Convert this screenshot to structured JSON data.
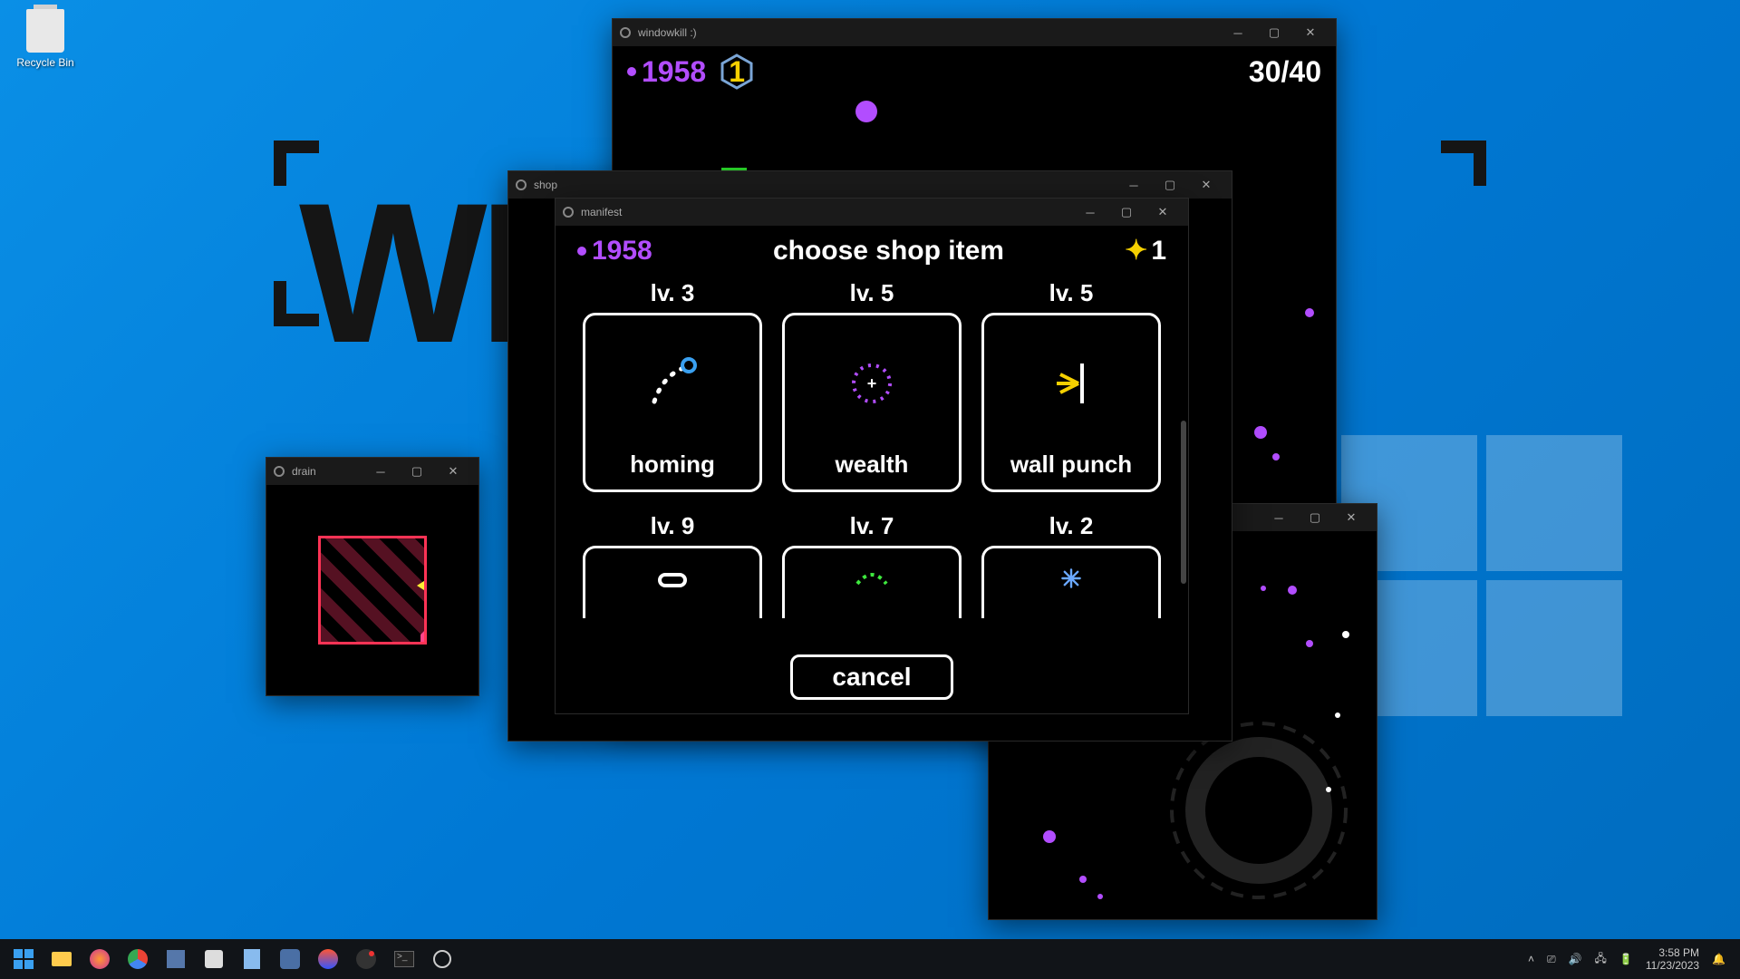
{
  "desktop": {
    "recycle_bin": "Recycle Bin",
    "wallpaper_text": "WI        L"
  },
  "main_window": {
    "title": "windowkill :)",
    "score": "1958",
    "hex_count": "1",
    "hp": "30/40"
  },
  "shop_window": {
    "title": "shop"
  },
  "manifest_window": {
    "title": "manifest",
    "score": "1958",
    "header": "choose shop item",
    "star_count": "1",
    "items": [
      {
        "level": "lv. 3",
        "name": "homing"
      },
      {
        "level": "lv. 5",
        "name": "wealth"
      },
      {
        "level": "lv. 5",
        "name": "wall punch"
      },
      {
        "level": "lv. 9",
        "name": ""
      },
      {
        "level": "lv. 7",
        "name": ""
      },
      {
        "level": "lv. 2",
        "name": ""
      }
    ],
    "cancel": "cancel"
  },
  "drain_window": {
    "title": "drain"
  },
  "taskbar": {
    "time": "3:58 PM",
    "date": "11/23/2023"
  }
}
